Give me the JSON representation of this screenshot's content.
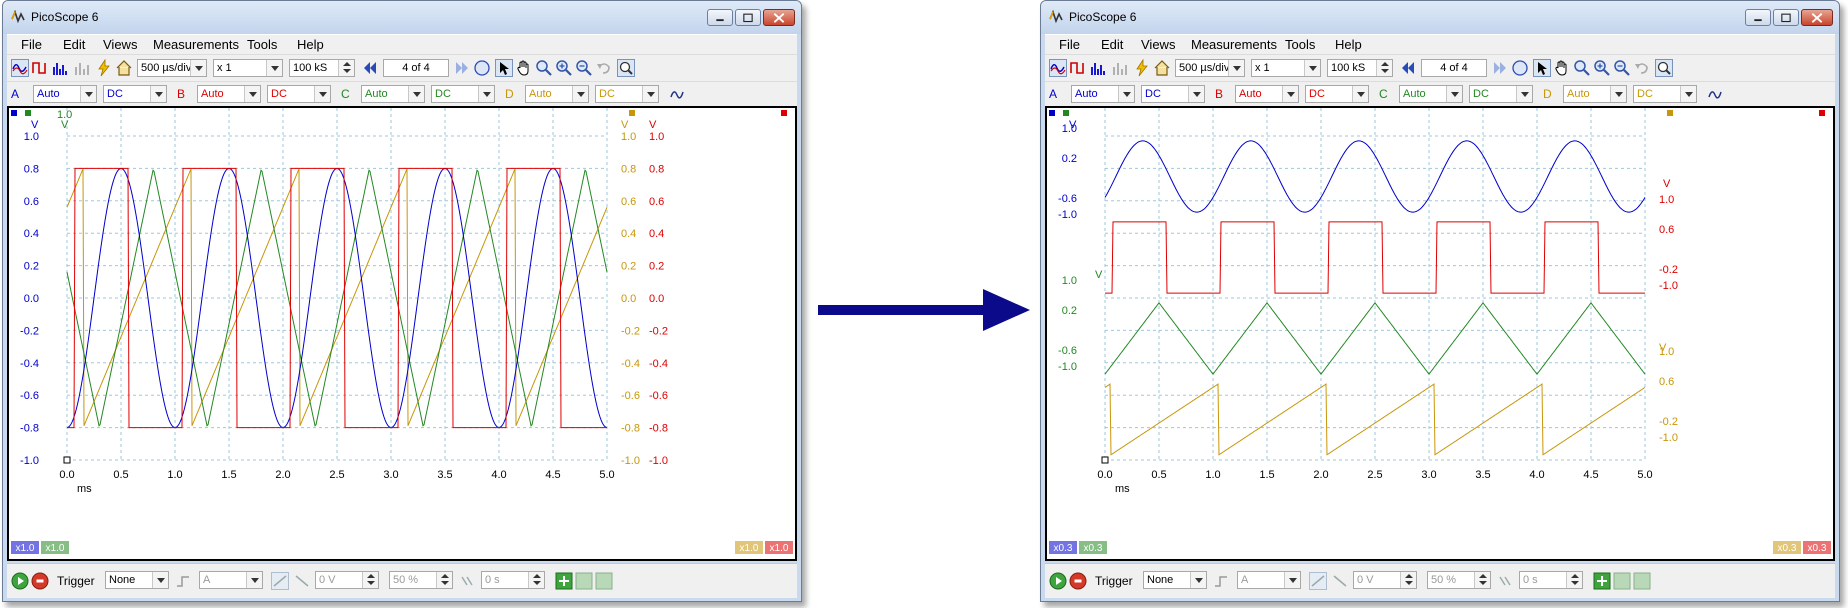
{
  "window_title": "PicoScope 6",
  "menu": [
    "File",
    "Edit",
    "Views",
    "Measurements",
    "Tools",
    "Help"
  ],
  "toolbar": {
    "timebase": "500 µs/div",
    "zoom": "x 1",
    "samples": "100 kS",
    "buffer": "4 of 4"
  },
  "channels": [
    {
      "letter": "A",
      "range": "Auto",
      "coupling": "DC",
      "color": "#0000cc"
    },
    {
      "letter": "B",
      "range": "Auto",
      "coupling": "DC",
      "color": "#dd0000"
    },
    {
      "letter": "C",
      "range": "Auto",
      "coupling": "DC",
      "color": "#228822"
    },
    {
      "letter": "D",
      "range": "Auto",
      "coupling": "DC",
      "color": "#c8960a"
    }
  ],
  "trigger": {
    "label": "Trigger",
    "mode": "None",
    "source": "A",
    "threshold": "0 V",
    "pretrigger": "50 %",
    "delay": "0 s"
  },
  "axis": {
    "x_ticks": [
      "0.0",
      "0.5",
      "1.0",
      "1.5",
      "2.0",
      "2.5",
      "3.0",
      "3.5",
      "4.0",
      "4.5",
      "5.0"
    ],
    "x_unit": "ms",
    "y_unit": "V",
    "y_ticks_full": [
      "1.0",
      "0.8",
      "0.6",
      "0.4",
      "0.2",
      "0.0",
      "-0.2",
      "-0.4",
      "-0.6",
      "-0.8",
      "-1.0"
    ]
  },
  "left_view": {
    "scale_left": [
      "x1.0",
      "x1.0"
    ],
    "scale_right": [
      "x1.0",
      "x1.0"
    ]
  },
  "right_view": {
    "scale_left": [
      "x0.3",
      "x0.3"
    ],
    "scale_right": [
      "x0.3",
      "x0.3"
    ],
    "labels_a": [
      "1.0",
      "0.2",
      "-0.6",
      "-1.0"
    ],
    "labels_b": [
      "1.0",
      "0.6",
      "-0.2",
      "-1.0"
    ],
    "labels_c": [
      "1.0",
      "0.2",
      "-0.6",
      "-1.0"
    ],
    "labels_d": [
      "1.0",
      "0.6",
      "-0.2",
      "-1.0"
    ]
  },
  "icon_names": [
    "picoscope-logo-icon",
    "scope-mode-icon",
    "persistence-mode-icon",
    "spectrum-mode-icon",
    "lightning-icon",
    "home-icon",
    "back-icon",
    "forward-icon",
    "pointer-icon",
    "hand-icon",
    "zoom-in-icon",
    "zoom-out-icon",
    "undo-icon",
    "run-icon",
    "stop-icon"
  ]
}
